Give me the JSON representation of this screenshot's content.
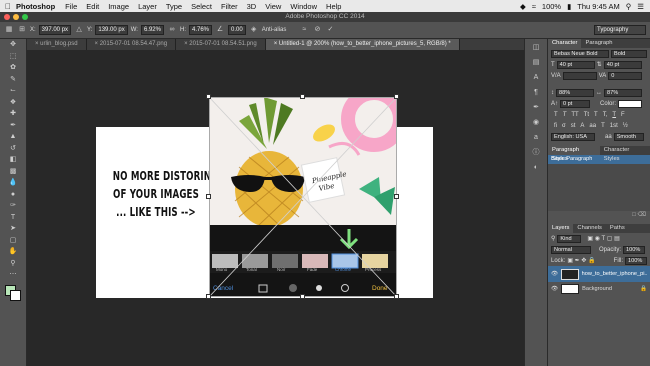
{
  "menubar": {
    "app_name": "Photoshop",
    "items": [
      "File",
      "Edit",
      "Image",
      "Layer",
      "Type",
      "Select",
      "Filter",
      "3D",
      "View",
      "Window",
      "Help"
    ],
    "clock": "Thu 9:45 AM",
    "battery": "100%"
  },
  "window": {
    "title": "Adobe Photoshop CC 2014"
  },
  "options": {
    "x_label": "X:",
    "x_value": "397.00 px",
    "y_label": "Y:",
    "y_value": "139.00 px",
    "w_label": "W:",
    "w_value": "6.92%",
    "h_label": "H:",
    "h_value": "4.76%",
    "angle_value": "0.00",
    "h_skew_label": "H:",
    "h_skew_value": "0.00",
    "v_skew_label": "V:",
    "v_skew_value": "0.00",
    "antialias_label": "Anti-alias",
    "workspace": "Typography"
  },
  "tabs": [
    {
      "label": "urlin_blog.psd"
    },
    {
      "label": "2015-07-01 08.54.47.png"
    },
    {
      "label": "2015-07-01 08.54.51.png"
    },
    {
      "label": "Untitled-1 @ 200% (how_to_better_iphone_pictures_5, RGB/8) *"
    }
  ],
  "document": {
    "headline": [
      "NO MORE DISTORING",
      "OF YOUR IMAGES",
      "... LIKE THIS -->"
    ],
    "photo_text": "Pineapple\nVibe",
    "filters": [
      "Mono",
      "Tonal",
      "Noir",
      "Fade",
      "Chrome",
      "Process"
    ],
    "cancel": "Cancel",
    "done": "Done"
  },
  "character_panel": {
    "tabs": [
      "Character",
      "Paragraph"
    ],
    "font_family": "Bebas Neue Bold",
    "font_style": "Bold",
    "font_size": "40 pt",
    "leading": "40 pt",
    "kerning": "",
    "tracking": "0",
    "vertical_scale": "88%",
    "horizontal_scale": "87%",
    "baseline_shift": "0 pt",
    "color_label": "Color:",
    "language": "English: USA",
    "antialias": "Smooth",
    "anti_alias_short": "aa",
    "style_buttons": [
      "T",
      "T",
      "TT",
      "Tt",
      "T",
      "T,",
      "T",
      "F"
    ],
    "opentype_buttons": [
      "fi",
      "σ",
      "st",
      "A",
      "aa",
      "T",
      "1st",
      "½"
    ]
  },
  "paragraph_styles": {
    "tabs": [
      "Paragraph Styles",
      "Character Styles"
    ],
    "items": [
      "Basic Paragraph"
    ]
  },
  "layers_panel": {
    "tabs": [
      "Layers",
      "Channels",
      "Paths"
    ],
    "kind": "Kind",
    "blend_mode": "Normal",
    "opacity_label": "Opacity:",
    "opacity": "100%",
    "lock_label": "Lock:",
    "fill_label": "Fill:",
    "fill": "100%",
    "layers": [
      {
        "name": "how_to_better_iphone_pi..."
      },
      {
        "name": "Background"
      }
    ]
  },
  "colors": {
    "foreground": "#b8e6b8",
    "background": "#ffffff",
    "accent": "#3d6d99",
    "arrow": "#7fe07f"
  }
}
